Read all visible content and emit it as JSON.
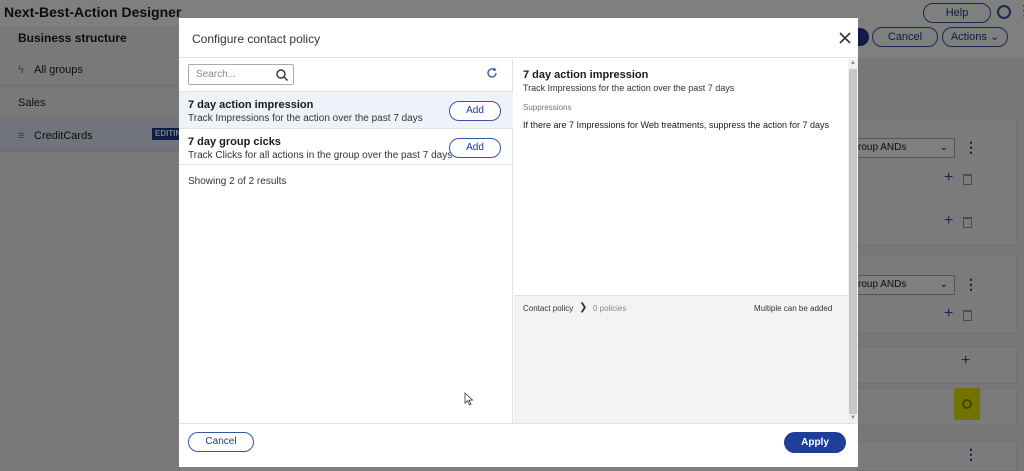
{
  "app": {
    "title": "Next-Best-Action Designer",
    "help_label": "Help",
    "cancel_label": "Cancel",
    "actions_label": "Actions"
  },
  "left_panel": {
    "title": "Business structure",
    "items": [
      {
        "label": "All groups",
        "icon": "bolt-icon"
      },
      {
        "label": "Sales"
      },
      {
        "label": "CreditCards",
        "icon": "stack-icon",
        "badge": "EDITIN"
      }
    ]
  },
  "background_cards": {
    "select_1": "roup ANDs",
    "select_2": "roup ANDs"
  },
  "modal": {
    "title": "Configure contact policy",
    "search_placeholder": "Search...",
    "items": [
      {
        "title": "7 day action impression",
        "description": "Track Impressions for the action over the past 7 days",
        "add_label": "Add"
      },
      {
        "title": "7 day group cicks",
        "description": "Track Clicks for all actions in the group over the past 7 days",
        "add_label": "Add"
      }
    ],
    "results_text": "Showing 2 of 2 results",
    "detail": {
      "title": "7 day action impression",
      "description": "Track Impressions for the action over the past 7 days",
      "suppressions_label": "Suppressions",
      "suppressions_text": "If there are 7 Impressions for Web treatments, suppress the action for 7 days",
      "contact_policy_label": "Contact policy",
      "policies_count": "0  policies",
      "multiple_note": "Multiple can be added"
    },
    "cancel_label": "Cancel",
    "apply_label": "Apply"
  },
  "colors": {
    "accent": "#1d3f9a",
    "highlight": "#e6e600"
  }
}
